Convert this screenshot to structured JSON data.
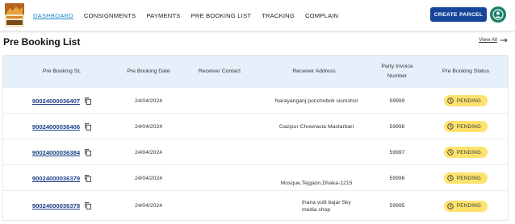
{
  "nav": {
    "items": [
      "DASHBOARD",
      "CONSIGNMENTS",
      "PAYMENTS",
      "PRE BOOKING LIST",
      "TRACKING",
      "COMPLAIN"
    ],
    "active_index": 0,
    "create_label": "CREATE PARCEL"
  },
  "page": {
    "title": "Pre Booking List",
    "view_all": "View All"
  },
  "table": {
    "headers": {
      "sl": "Pre Booking SL",
      "date": "Pre Booking Date",
      "contact": "Receiver Contact",
      "address": "Receiver Address",
      "invoice_line1": "Party Invoice",
      "invoice_line2": "Number",
      "status": "Pre Booking Status"
    },
    "rows": [
      {
        "sl": "90024000036407",
        "date": "24/04/2024",
        "contact": "",
        "address": "Narayanganj ponchoboti sismohol",
        "invoice": "59999",
        "status": "PENDING"
      },
      {
        "sl": "90024000036406",
        "date": "24/04/2024",
        "contact": "",
        "address": "Gazipur Chowrasta Mastarbari",
        "invoice": "59998",
        "status": "PENDING"
      },
      {
        "sl": "90024000036384",
        "date": "24/04/2024",
        "contact": "",
        "address": "",
        "invoice": "59997",
        "status": "PENDING"
      },
      {
        "sl": "90024000036379",
        "date": "24/04/2024",
        "contact": "",
        "address": "Mosque,Tejgaon,Dhaka-1215",
        "invoice": "59996",
        "status": "PENDING"
      },
      {
        "sl": "90024000036378",
        "date": "24/04/2024",
        "contact": "",
        "address": "thana vulli bajar Sky media shop",
        "invoice": "59995",
        "status": "PENDING"
      }
    ]
  },
  "colors": {
    "primary": "#17459a",
    "active_tab": "#1e88c8",
    "header_bg": "#e6f0fb",
    "pending_badge": "#fde36e",
    "avatar": "#188068"
  }
}
